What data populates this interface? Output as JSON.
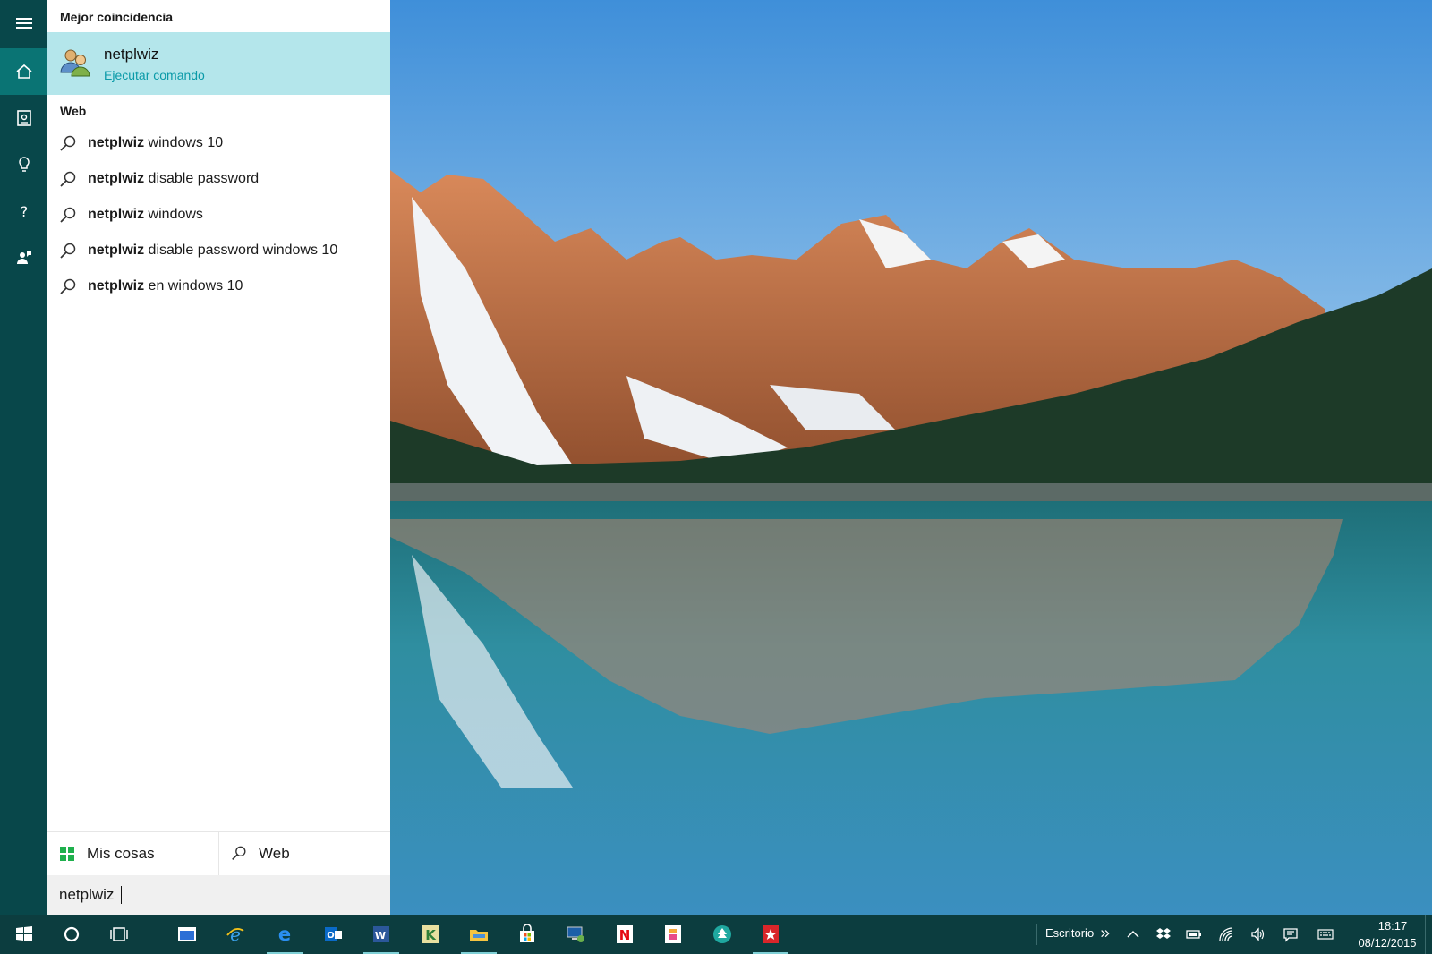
{
  "start_panel": {
    "best_match_title": "Mejor coincidencia",
    "best_match": {
      "name": "netplwiz",
      "subtitle": "Ejecutar comando",
      "icon": "users-icon"
    },
    "web_title": "Web",
    "suggestions": [
      {
        "bold": "netplwiz",
        "rest": " windows 10"
      },
      {
        "bold": "netplwiz",
        "rest": " disable password"
      },
      {
        "bold": "netplwiz",
        "rest": " windows"
      },
      {
        "bold": "netplwiz",
        "rest": " disable password windows 10"
      },
      {
        "bold": "netplwiz",
        "rest": " en windows 10"
      }
    ],
    "scope_mine": "Mis cosas",
    "scope_web": "Web",
    "search_value": "netplwiz"
  },
  "rail": {
    "items": [
      "menu-icon",
      "home-icon",
      "notebook-icon",
      "lightbulb-icon",
      "help-icon",
      "feedback-icon"
    ]
  },
  "taskbar": {
    "desktop_label": "Escritorio",
    "time": "18:17",
    "date": "08/12/2015",
    "apps": [
      "windows-start-icon",
      "cortana-icon",
      "task-view-icon",
      "window-app-icon",
      "internet-explorer-icon",
      "edge-icon",
      "outlook-icon",
      "word-icon",
      "kindle-icon",
      "file-explorer-icon",
      "store-icon",
      "remote-desktop-icon",
      "netflix-icon",
      "photos-app-icon",
      "tree-app-icon",
      "red-star-app-icon"
    ]
  },
  "colors": {
    "rail_bg": "#08474a",
    "rail_active": "#0a7474",
    "best_match_bg": "#b4e6eb",
    "accent_text": "#0a9aa8",
    "taskbar_bg": "#0c3d3f"
  }
}
